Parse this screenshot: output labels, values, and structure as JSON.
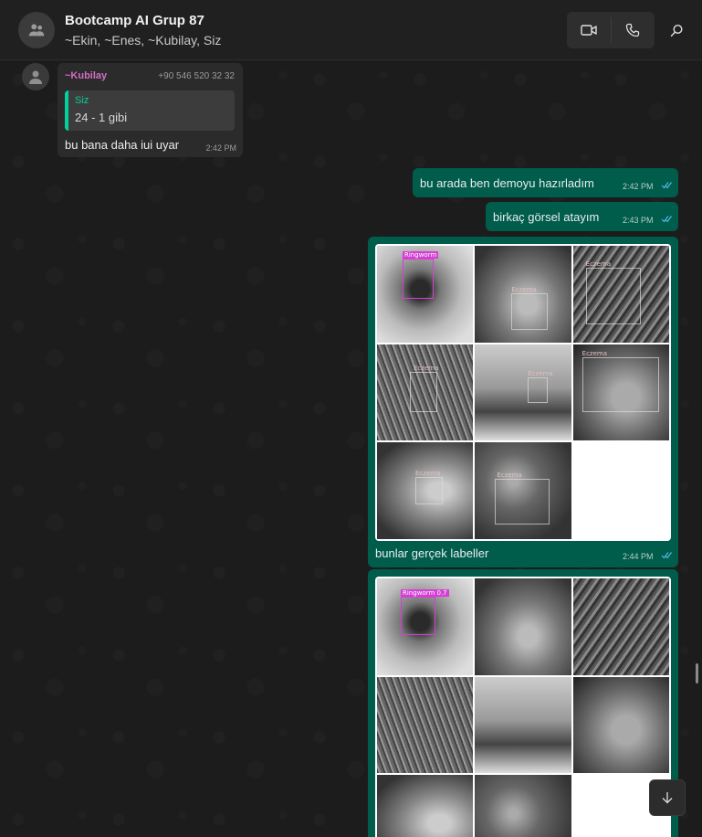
{
  "header": {
    "group_name": "Bootcamp AI Grup 87",
    "members": "~Ekin, ~Enes, ~Kubilay, Siz",
    "icons": [
      "group-avatar-icon",
      "video-call-icon",
      "voice-call-icon",
      "search-icon"
    ]
  },
  "messages": {
    "incoming": {
      "sender": "~Kubilay",
      "phone": "+90 546 520 32 32",
      "quote_author": "Siz",
      "quote_text": "24 - 1 gibi",
      "text": "bu bana daha iui uyar",
      "time": "2:42 PM"
    },
    "out1": {
      "text": "bu arada ben demoyu hazırladım",
      "time": "2:42 PM"
    },
    "out2": {
      "text": "birkaç görsel atayım",
      "time": "2:43 PM"
    },
    "out3": {
      "caption": "bunlar gerçek labeller",
      "time": "2:44 PM",
      "tile_labels": [
        "Ringworm",
        "Eczema",
        "Eczema",
        "Eczema",
        "Eczema",
        "Eczema",
        "Eczema",
        "Eczema"
      ]
    },
    "out4": {
      "tile_labels": [
        "Ringworm 0.7"
      ]
    }
  },
  "colors": {
    "outgoing_bubble": "#005c4b",
    "incoming_bubble": "#2b2b2b",
    "accent": "#06cf9c",
    "sender_name": "#d36ec6",
    "read_ticks": "#53bdeb"
  }
}
